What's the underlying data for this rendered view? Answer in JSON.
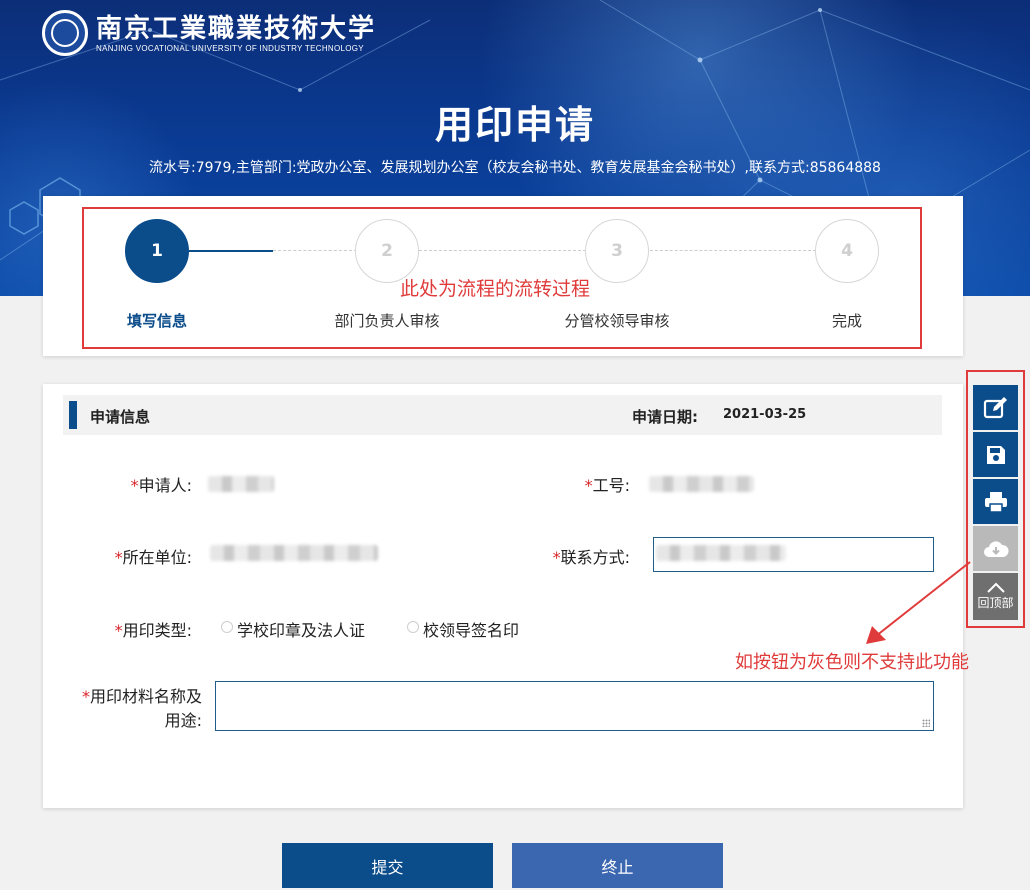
{
  "header": {
    "logo_cn": "南京工業職業技術大学",
    "logo_en": "NANJING VOCATIONAL UNIVERSITY OF INDUSTRY TECHNOLOGY",
    "title": "用印申请",
    "sub_info": "流水号:7979,主管部门:党政办公室、发展规划办公室（校友会秘书处、教育发展基金会秘书处）,联系方式:85864888"
  },
  "steps": [
    {
      "number": "1",
      "label": "填写信息",
      "active": true
    },
    {
      "number": "2",
      "label": "部门负责人审核",
      "active": false
    },
    {
      "number": "3",
      "label": "分管校领导审核",
      "active": false
    },
    {
      "number": "4",
      "label": "完成",
      "active": false
    }
  ],
  "annotations": {
    "steps_note": "此处为流程的流转过程",
    "tools_note": "如按钮为灰色则不支持此功能"
  },
  "form": {
    "section_title": "申请信息",
    "date_label": "申请日期:",
    "date_value": "2021-03-25",
    "required_mark": "*",
    "fields": {
      "applicant": "申请人:",
      "staff_no": "工号:",
      "unit": "所在单位:",
      "contact": "联系方式:",
      "seal_type": "用印类型:",
      "material_line1": "用印材料名称及",
      "material_line2": "用途:"
    },
    "seal_options": [
      "学校印章及法人证",
      "校领导签名印"
    ]
  },
  "buttons": {
    "submit": "提交",
    "stop": "终止"
  },
  "tools": {
    "back_to_top": "回顶部",
    "icons": [
      "edit-icon",
      "save-icon",
      "print-icon",
      "cloud-download-icon",
      "chevron-up-icon"
    ],
    "download_disabled": true
  },
  "colors": {
    "primary": "#0b4c8b",
    "stop_button": "#3b66b0",
    "annotation": "#e03b3b",
    "required": "#d9262c",
    "disabled": "#b9b9b9"
  }
}
